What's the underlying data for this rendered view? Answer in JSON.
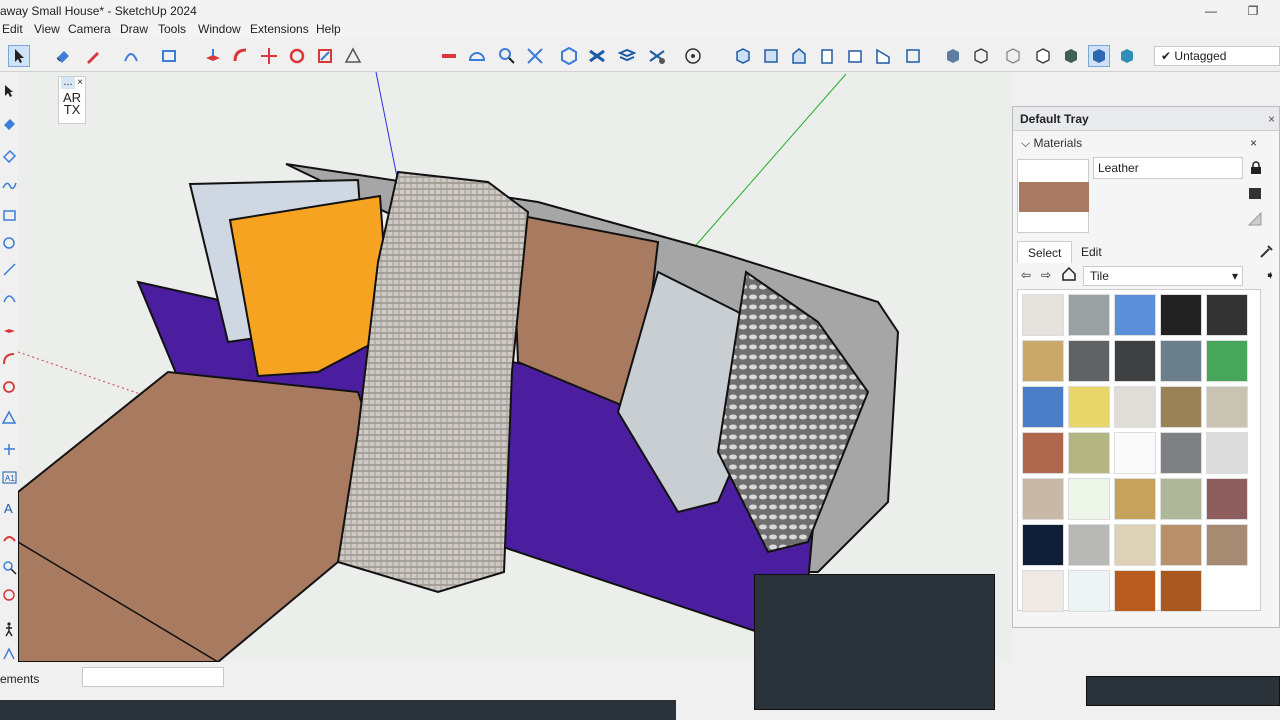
{
  "window": {
    "title": "away Small House* - SketchUp 2024",
    "minimize_glyph": "—",
    "maximize_glyph": "❐"
  },
  "menu": [
    "Edit",
    "View",
    "Camera",
    "Draw",
    "Tools",
    "Window",
    "Extensions",
    "Help"
  ],
  "toolbar": {
    "tag_dropdown": "Untagged",
    "tag_check": "✔"
  },
  "overlay": {
    "mini_dots": "...",
    "mini_close": "×",
    "artx_line1": "AR",
    "artx_line2": "TX"
  },
  "tray": {
    "title": "Default Tray",
    "close": "×",
    "section": "Materials",
    "section_close": "×",
    "material_name": "Leather",
    "tabs": [
      "Select",
      "Edit"
    ],
    "library": "Tile",
    "colors": {
      "current_material": "#a97a62",
      "accent": "#cfe3f7"
    },
    "tiles": [
      "#e5e3de",
      "#9aa1a3",
      "#5c8fd8",
      "#222222",
      "#333333",
      "#c9a86a",
      "#5f6366",
      "#3e4042",
      "#6b7f8c",
      "#47a65a",
      "#4a7fc7",
      "#e8d66a",
      "#e0ddd8",
      "#9a8258",
      "#c9c3b2",
      "#b0684c",
      "#b3b582",
      "#fafafa",
      "#7e8083",
      "#dcdcdc",
      "#c8b8a8",
      "#eef6ea",
      "#c6a35a",
      "#afb79a",
      "#8e5e5e",
      "#0f1e36",
      "#b8b9b6",
      "#ddd1b8",
      "#b8916a",
      "#a78a72",
      "#efe9e6",
      "#eef3f6",
      "#b85c20",
      "#a9581f"
    ]
  },
  "status": {
    "measurements_label": "ements"
  }
}
